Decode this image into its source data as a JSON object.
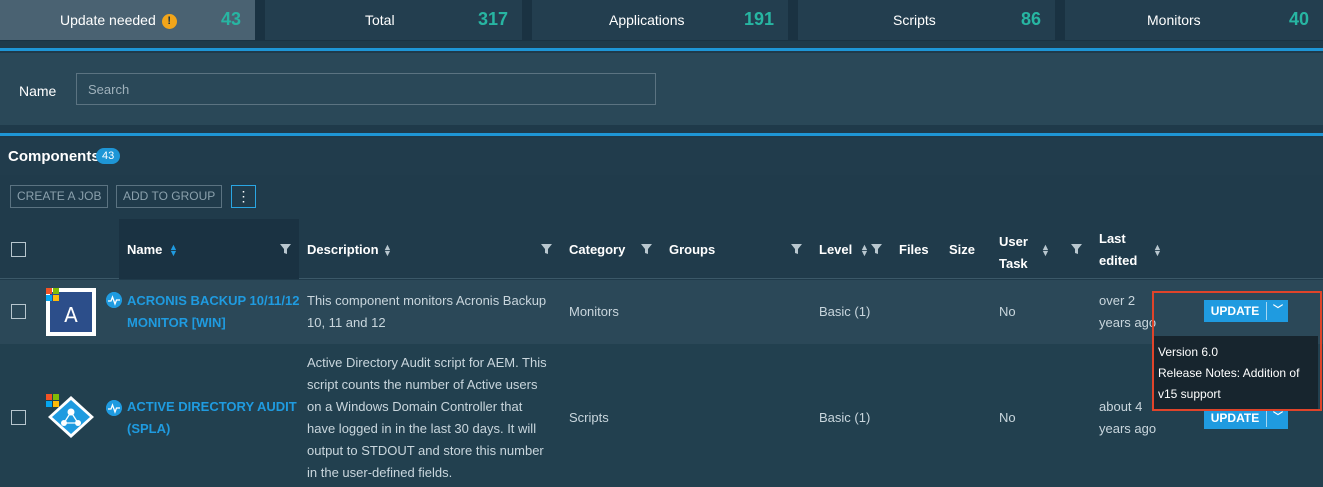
{
  "stats": [
    {
      "label": "Update needed",
      "value": "43",
      "warning": "!"
    },
    {
      "label": "Total",
      "value": "317"
    },
    {
      "label": "Applications",
      "value": "191"
    },
    {
      "label": "Scripts",
      "value": "86"
    },
    {
      "label": "Monitors",
      "value": "40"
    }
  ],
  "filter": {
    "name_label": "Name",
    "search_placeholder": "Search"
  },
  "components": {
    "title": "Components",
    "count": "43"
  },
  "actions": {
    "create_job": "CREATE A JOB",
    "add_to_group": "ADD TO GROUP",
    "more": "⋮"
  },
  "columns": {
    "name": "Name",
    "description": "Description",
    "category": "Category",
    "groups": "Groups",
    "level": "Level",
    "files": "Files",
    "size": "Size",
    "user_task_1": "User",
    "user_task_2": "Task",
    "last_edited_1": "Last",
    "last_edited_2": "edited"
  },
  "rows": [
    {
      "name_1": "ACRONIS BACKUP 10/11/12",
      "name_2": "MONITOR [WIN]",
      "description": [
        "This component monitors Acronis Backup",
        "10, 11 and 12"
      ],
      "category": "Monitors",
      "level": "Basic (1)",
      "user_task": "No",
      "edited_1": "over 2",
      "edited_2": "years ago",
      "update": "UPDATE"
    },
    {
      "name_1": "ACTIVE DIRECTORY AUDIT",
      "name_2": "(SPLA)",
      "description": [
        "Active Directory Audit script for AEM. This",
        "script counts the number of Active users",
        "on a Windows Domain Controller that",
        "have logged in in the last 30 days. It will",
        "output to STDOUT and store this number",
        "in the user-defined fields."
      ],
      "category": "Scripts",
      "level": "Basic (1)",
      "user_task": "No",
      "edited_1": "about 4",
      "edited_2": "years ago",
      "update": "UPDATE"
    }
  ],
  "tooltip": {
    "line1": "Version 6.0",
    "line2": "Release Notes: Addition of",
    "line3": "v15 support"
  },
  "colors": {
    "accent": "#1f9be0",
    "count": "#27b5a2",
    "highlight": "#e0442a",
    "warning": "#f2a51a"
  }
}
